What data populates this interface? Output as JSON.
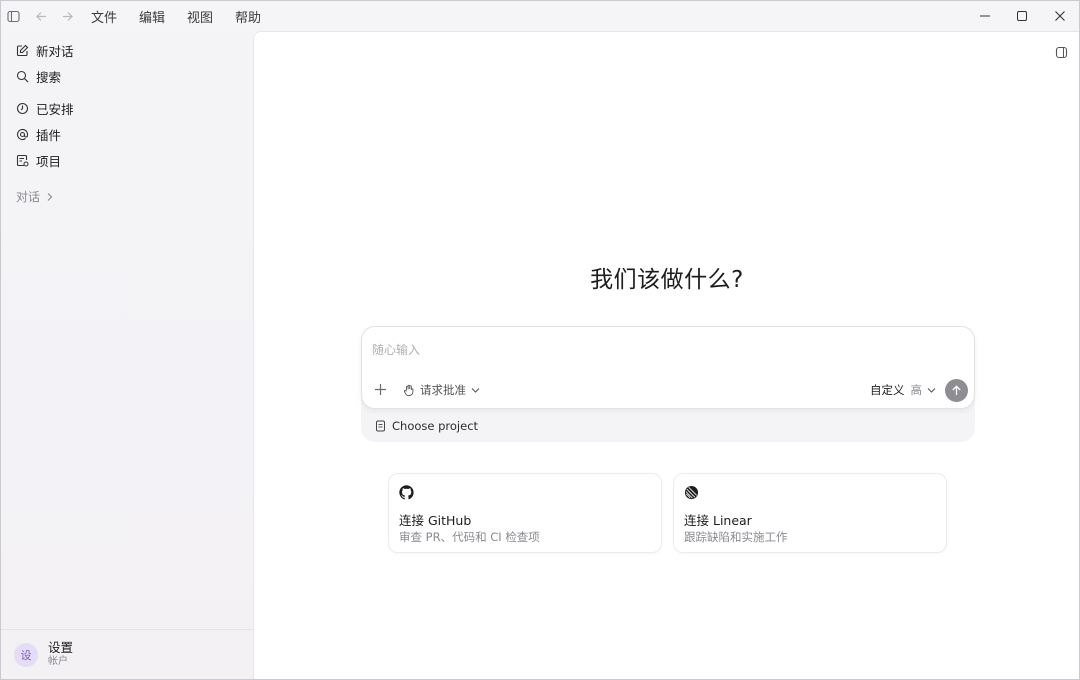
{
  "menu": {
    "file": "文件",
    "edit": "编辑",
    "view": "视图",
    "help": "帮助"
  },
  "sidebar": {
    "items": [
      {
        "label": "新对话",
        "icon": "edit-icon"
      },
      {
        "label": "搜索",
        "icon": "search-icon"
      },
      {
        "label": "已安排",
        "icon": "clock-icon"
      },
      {
        "label": "插件",
        "icon": "at-icon"
      },
      {
        "label": "项目",
        "icon": "folder-icon"
      }
    ],
    "section_label": "对话",
    "footer": {
      "avatar_text": "设",
      "title": "设置",
      "subtitle": "帐户"
    }
  },
  "main": {
    "heading": "我们该做什么?",
    "composer": {
      "placeholder": "随心输入",
      "approval_label": "请求批准",
      "model_label": "自定义",
      "effort_label": "高",
      "project_label": "Choose project"
    },
    "cards": [
      {
        "title": "连接 GitHub",
        "subtitle": "审查 PR、代码和 CI 检查项",
        "icon": "github-icon"
      },
      {
        "title": "连接 Linear",
        "subtitle": "跟踪缺陷和实施工作",
        "icon": "linear-icon"
      }
    ]
  },
  "colors": {
    "accent_avatar_bg": "#e5dcf7",
    "send_button": "#8d8d92"
  }
}
